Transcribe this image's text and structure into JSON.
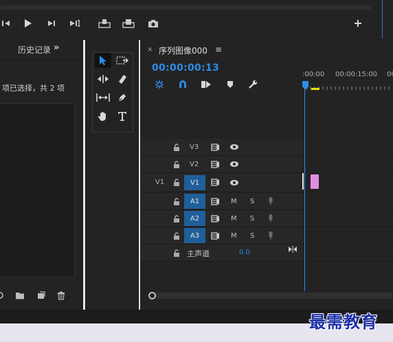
{
  "history": {
    "tab_label": "历史记录",
    "more_glyph": "»",
    "status": "项已选择，共 2 项"
  },
  "timeline": {
    "sequence_name": "序列图像000",
    "close_glyph": "×",
    "menu_glyph": "≡",
    "timecode": "00:00:00:13",
    "ruler_labels": [
      ":00:00",
      "00:00:15:00",
      "00"
    ],
    "tracks": {
      "v3": "V3",
      "v2": "V2",
      "v1": "V1",
      "v1_source": "V1",
      "a1": "A1",
      "a2": "A2",
      "a3": "A3",
      "mute": "M",
      "solo": "S"
    },
    "master_label": "主声道",
    "master_value": "0.0"
  },
  "watermark": "最需教育",
  "colors": {
    "accent": "#2d8ceb",
    "track_target": "#1f5f9a",
    "clip": "#e08fe0",
    "work_area": "#e6e600",
    "watermark": "#1c2fa8"
  }
}
